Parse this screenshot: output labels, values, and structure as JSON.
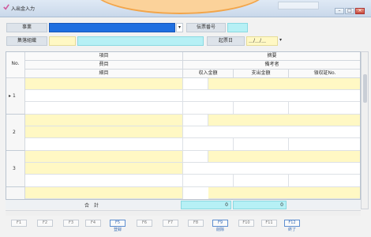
{
  "window": {
    "title": "入出金入力",
    "btn_min": "–",
    "btn_max": "□",
    "btn_close": "×"
  },
  "form": {
    "jigyo_label": "事業",
    "denpyo_label": "伝票番号",
    "shukei_label": "集落組織",
    "kiten_label": "起票日",
    "date_value": "＿/＿/＿",
    "drop_glyph": "▾"
  },
  "grid": {
    "headers": {
      "no": "No.",
      "koumoku": "項目",
      "himoku": "費目",
      "saimoku": "細目",
      "tekiyo": "摘要",
      "bikousha": "備考者",
      "shunyu": "収入金額",
      "shishutsu": "支出金額",
      "ryoshu": "領収証No."
    },
    "rows": [
      {
        "no": "1",
        "current": "▸"
      },
      {
        "no": "2"
      },
      {
        "no": "3"
      }
    ]
  },
  "totals": {
    "label": "合　計",
    "income": "0",
    "expense": "0"
  },
  "fkeys": [
    {
      "key": "F1",
      "label": ""
    },
    {
      "key": "F2",
      "label": ""
    },
    {
      "key": "F3",
      "label": ""
    },
    {
      "key": "F4",
      "label": ""
    },
    {
      "key": "F5",
      "label": "登録"
    },
    {
      "key": "F6",
      "label": ""
    },
    {
      "key": "F7",
      "label": ""
    },
    {
      "key": "F8",
      "label": ""
    },
    {
      "key": "F9",
      "label": "削除"
    },
    {
      "key": "F10",
      "label": ""
    },
    {
      "key": "F11",
      "label": ""
    },
    {
      "key": "F12",
      "label": "終了"
    }
  ],
  "colors": {
    "accent": "#1f6fe0",
    "input_yellow": "#fff8c4",
    "input_cyan": "#b6f0f5"
  }
}
